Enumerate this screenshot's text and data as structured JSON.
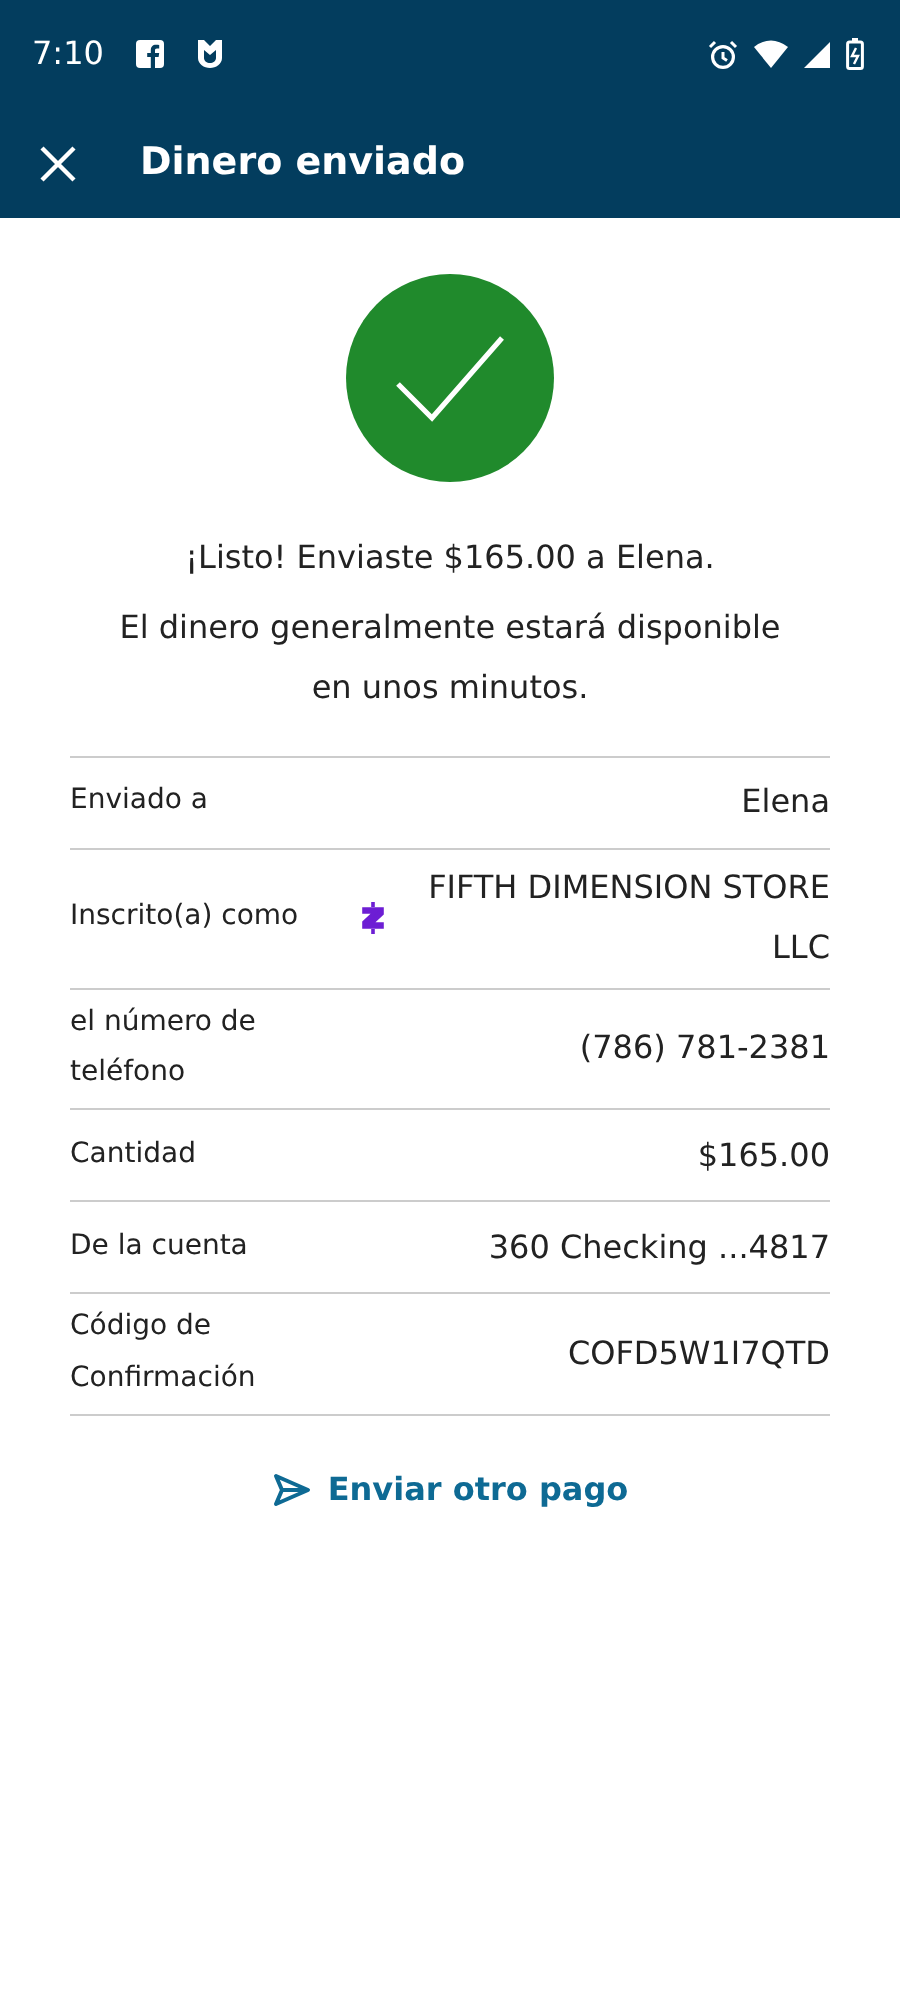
{
  "status_bar": {
    "time": "7:10"
  },
  "app_bar": {
    "title": "Dinero enviado"
  },
  "message": "¡Listo! Enviaste $165.00 a Elena.",
  "note": "El dinero generalmente estará disponible en unos minutos.",
  "details": [
    {
      "label": "Enviado a",
      "value": "Elena",
      "kind": "plain"
    },
    {
      "label": "Inscrito(a) como",
      "value": "FIFTH DIMENSION STORE LLC",
      "kind": "zelle"
    },
    {
      "label": "el número de teléfono",
      "value": "(786) 781-2381",
      "kind": "plain"
    },
    {
      "label": "Cantidad",
      "value": "$165.00",
      "kind": "plain"
    },
    {
      "label": "De la cuenta",
      "value": "360 Checking ...4817",
      "kind": "plain"
    },
    {
      "label": "Código de Confirmación",
      "value": "COFD5W1I7QTD",
      "kind": "plain"
    }
  ],
  "action": "Enviar otro pago"
}
